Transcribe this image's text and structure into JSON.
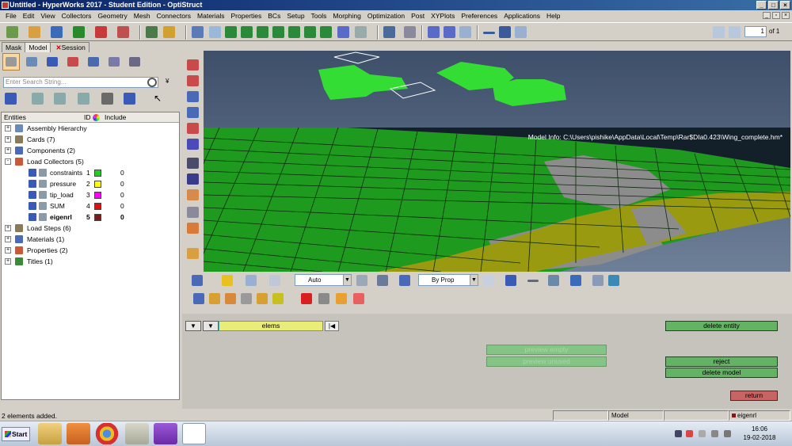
{
  "window": {
    "title": "Untitled - HyperWorks 2017 - Student Edition - OptiStruct"
  },
  "menu": [
    "File",
    "Edit",
    "View",
    "Collectors",
    "Geometry",
    "Mesh",
    "Connectors",
    "Materials",
    "Properties",
    "BCs",
    "Setup",
    "Tools",
    "Morphing",
    "Optimization",
    "Post",
    "XYPlots",
    "Preferences",
    "Applications",
    "Help"
  ],
  "toolbar": {
    "page_value": "1",
    "page_of": "of 1"
  },
  "browser": {
    "tabs": [
      "Mask",
      "Model",
      "Session"
    ],
    "search_placeholder": "Enter Search String...",
    "columns": [
      "Entities",
      "ID",
      "Include"
    ],
    "tree": [
      {
        "label": "Assembly Hierarchy",
        "sign": "+"
      },
      {
        "label": "Cards (7)",
        "sign": "+"
      },
      {
        "label": "Components (2)",
        "sign": "+"
      },
      {
        "label": "Load Collectors (5)",
        "sign": "-"
      },
      {
        "label": "constraints",
        "id": "1",
        "include": "0",
        "color": "#22cc22"
      },
      {
        "label": "pressure",
        "id": "2",
        "include": "0",
        "color": "#ffff00"
      },
      {
        "label": "tip_load",
        "id": "3",
        "include": "0",
        "color": "#ff00ff"
      },
      {
        "label": "SUM",
        "id": "4",
        "include": "0",
        "color": "#dd1111"
      },
      {
        "label": "eigenrl",
        "id": "5",
        "include": "0",
        "color": "#7a1a1a",
        "bold": true
      },
      {
        "label": "Load Steps (6)",
        "sign": "+"
      },
      {
        "label": "Materials (1)",
        "sign": "+"
      },
      {
        "label": "Properties (2)",
        "sign": "+"
      },
      {
        "label": "Titles (1)",
        "sign": "+"
      }
    ]
  },
  "viewport": {
    "model_info": "Model Info: C:\\Users\\pishike\\AppData\\Local\\Temp\\Rar$DIa0.423\\Wing_complete.hm*"
  },
  "view_toolbar": {
    "auto_label": "Auto",
    "byprop_label": "By Prop"
  },
  "panel": {
    "selector_label": "elems",
    "delete_entity": "delete entity",
    "preview_empty": "preview empty",
    "preview_unused": "preview unused",
    "reject": "reject",
    "delete_model": "delete model",
    "return": "return"
  },
  "status": {
    "message": "2 elements added.",
    "model": "Model",
    "collector": "eigenrl"
  },
  "taskbar": {
    "start": "Start",
    "time": "16:06",
    "date": "19-02-2018"
  },
  "colors": {
    "mesh_green": "#1e9a1e",
    "mesh_yellow": "#9a9a10",
    "mesh_gray": "#8c8c8c",
    "button_green": "#64b264",
    "button_red": "#c86464"
  }
}
